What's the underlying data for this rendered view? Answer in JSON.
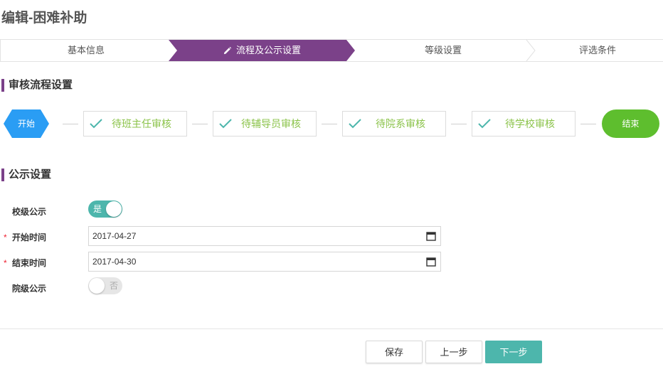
{
  "page": {
    "title": "编辑-困难补助"
  },
  "steps": [
    {
      "label": "基本信息",
      "active": false
    },
    {
      "label": "流程及公示设置",
      "active": true
    },
    {
      "label": "等级设置",
      "active": false
    },
    {
      "label": "评选条件",
      "active": false
    }
  ],
  "audit_section": {
    "title": "审核流程设置",
    "start_label": "开始",
    "end_label": "结束",
    "nodes": [
      {
        "label": "待班主任审核"
      },
      {
        "label": "待辅导员审核"
      },
      {
        "label": "待院系审核"
      },
      {
        "label": "待学校审核"
      }
    ]
  },
  "publicity_section": {
    "title": "公示设置",
    "school_publicity": {
      "label": "校级公示",
      "state_text": "是",
      "on": true
    },
    "start_time": {
      "label": "开始时间",
      "value": "2017-04-27"
    },
    "end_time": {
      "label": "结束时间",
      "value": "2017-04-30"
    },
    "college_publicity": {
      "label": "院级公示",
      "state_text": "否",
      "on": false
    }
  },
  "footer": {
    "save_label": "保存",
    "prev_label": "上一步",
    "next_label": "下一步"
  },
  "colors": {
    "accent_purple": "#7b4189",
    "start_blue": "#2a9df4",
    "end_green": "#5ebe2e",
    "teal": "#4db6ac",
    "node_text_green": "#8bc34a"
  },
  "icons": {
    "active_step": "pencil-icon",
    "node_done": "check-icon",
    "date_picker": "calendar-icon"
  }
}
